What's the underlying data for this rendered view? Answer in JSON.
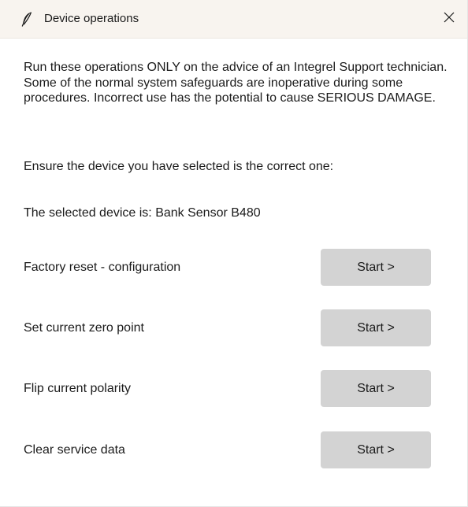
{
  "window": {
    "title": "Device operations",
    "close_glyph": "✕"
  },
  "body": {
    "warning": "Run these operations ONLY on the advice of an Integrel Support technician. Some of the normal system safeguards are inoperative during some procedures. Incorrect use has the potential to cause SERIOUS DAMAGE.",
    "ensure": "Ensure the device you have selected is the correct one:",
    "selected_device": "The selected device is: Bank Sensor B480"
  },
  "operations": [
    {
      "label": "Factory reset - configuration",
      "button": "Start >"
    },
    {
      "label": "Set current zero point",
      "button": "Start >"
    },
    {
      "label": "Flip current polarity",
      "button": "Start >"
    },
    {
      "label": "Clear service data",
      "button": "Start >"
    }
  ],
  "icons": {
    "app": "feather-icon",
    "close": "close-icon"
  }
}
